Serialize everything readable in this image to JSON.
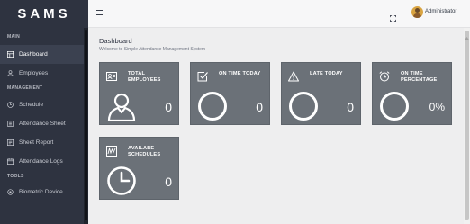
{
  "app": {
    "brand": "SAMS"
  },
  "sidebar": {
    "sections": [
      {
        "label": "MAIN"
      },
      {
        "label": "MANAGEMENT"
      },
      {
        "label": "TOOLS"
      }
    ],
    "items": [
      {
        "label": "Dashboard",
        "icon": "dashboard-icon",
        "active": true
      },
      {
        "label": "Employees",
        "icon": "user-icon"
      },
      {
        "label": "Schedule",
        "icon": "clock-icon"
      },
      {
        "label": "Attendance Sheet",
        "icon": "sheet-icon"
      },
      {
        "label": "Sheet Report",
        "icon": "report-icon"
      },
      {
        "label": "Attendance Logs",
        "icon": "calendar-icon"
      },
      {
        "label": "Biometric Device",
        "icon": "fingerprint-icon"
      }
    ]
  },
  "topbar": {
    "user": "Administrator"
  },
  "page": {
    "title": "Dashboard",
    "subtitle": "Welcome to Simple Attendance Management System"
  },
  "cards": [
    {
      "label": "TOTAL EMPLOYEES",
      "value": "0",
      "icon": "id-card-icon",
      "big_icon": "person-icon"
    },
    {
      "label": "ON TIME TODAY",
      "value": "0",
      "icon": "check-square-icon",
      "big_icon": "circle-icon"
    },
    {
      "label": "LATE TODAY",
      "value": "0",
      "icon": "warning-icon",
      "big_icon": "circle-icon"
    },
    {
      "label": "ON TIME PERCENTAGE",
      "value": "0%",
      "icon": "alarm-clock-icon",
      "big_icon": "circle-icon"
    },
    {
      "label": "AVAILABE SCHEDULES",
      "value": "0",
      "icon": "schedule-icon",
      "big_icon": "clock-icon"
    }
  ],
  "colors": {
    "sidebar_bg": "#2e3340",
    "card_bg": "#6b7178",
    "content_bg": "#eeeeef"
  }
}
